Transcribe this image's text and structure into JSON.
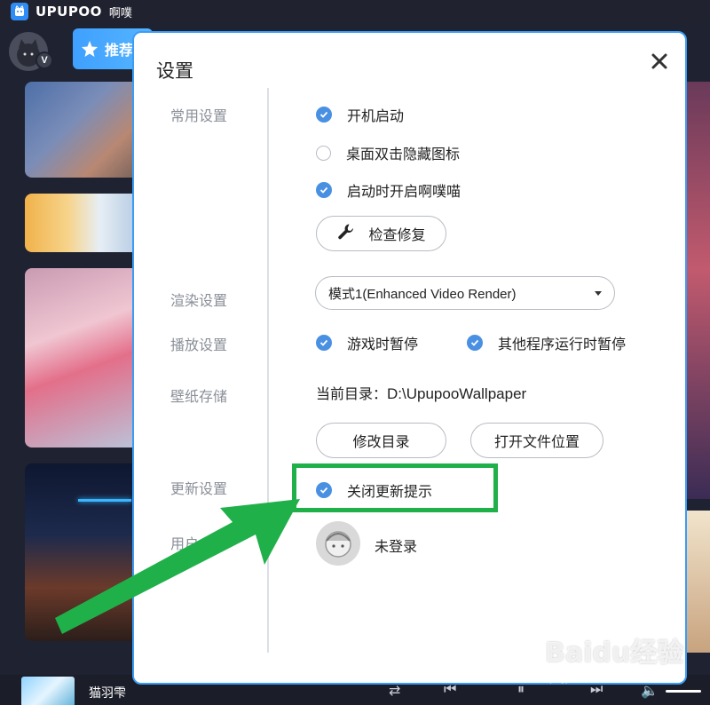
{
  "app": {
    "logo_text": "UPUPOO",
    "app_name": "啊噗",
    "vip_badge": "V",
    "rec_tab_label": "推荐"
  },
  "player": {
    "track_title": "猫羽雫"
  },
  "dialog": {
    "title": "设置",
    "sections": {
      "general": "常用设置",
      "render": "渲染设置",
      "playback": "播放设置",
      "storage": "壁纸存储",
      "update": "更新设置",
      "user": "用户"
    },
    "general": {
      "autostart": {
        "label": "开机启动",
        "checked": true
      },
      "hide_icons": {
        "label": "桌面双击隐藏图标",
        "checked": false
      },
      "open_on_start": {
        "label": "启动时开启啊噗喵",
        "checked": true
      },
      "repair_button": "检查修复"
    },
    "render": {
      "mode_selected": "模式1(Enhanced Video Render)"
    },
    "playback": {
      "pause_game": {
        "label": "游戏时暂停",
        "checked": true
      },
      "pause_other": {
        "label": "其他程序运行时暂停",
        "checked": true
      }
    },
    "storage": {
      "dir_label": "当前目录：",
      "dir_path": "D:\\UpupooWallpaper",
      "change_dir_button": "修改目录",
      "open_location_button": "打开文件位置"
    },
    "update": {
      "close_prompt": {
        "label": "关闭更新提示",
        "checked": true
      }
    },
    "user": {
      "status": "未登录"
    }
  },
  "watermark": {
    "text": "Baidu经验",
    "url": "jingyan.baidu.com"
  },
  "colors": {
    "accent": "#4a90e2",
    "dialog_border": "#3b9cf5",
    "annotation": "#1fb04a",
    "app_bg": "#1f2230"
  }
}
